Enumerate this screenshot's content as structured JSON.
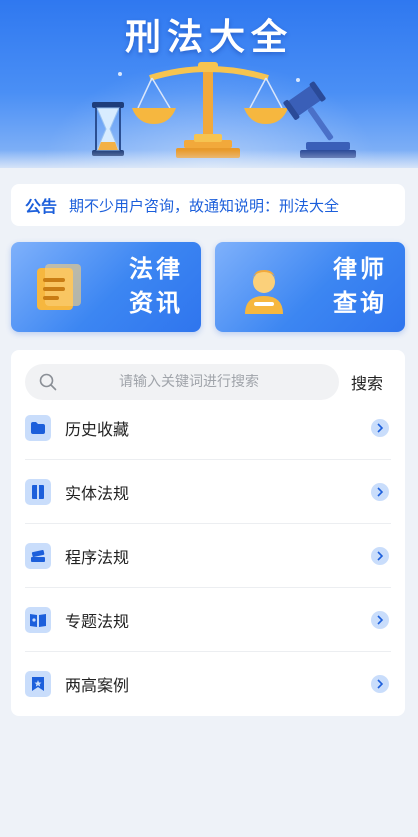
{
  "banner": {
    "title": "刑法大全"
  },
  "notice": {
    "label": "公告",
    "text": "期不少用户咨询，故通知说明：刑法大全"
  },
  "cards": [
    {
      "label_line1": "法律",
      "label_line2": "资讯",
      "icon": "document-icon"
    },
    {
      "label_line1": "律师",
      "label_line2": "查询",
      "icon": "lawyer-icon"
    }
  ],
  "search": {
    "placeholder": "请输入关键词进行搜索",
    "button_label": "搜索"
  },
  "list": {
    "items": [
      {
        "label": "历史收藏",
        "icon": "folder-icon"
      },
      {
        "label": "实体法规",
        "icon": "book-icon"
      },
      {
        "label": "程序法规",
        "icon": "books-stack-icon"
      },
      {
        "label": "专题法规",
        "icon": "open-book-icon"
      },
      {
        "label": "两高案例",
        "icon": "bookmark-star-icon"
      }
    ]
  },
  "colors": {
    "accent": "#2f75ee",
    "notice_text": "#1c5fdb",
    "icon_bg": "#c9ddfb",
    "page_bg": "#eef2f8"
  }
}
